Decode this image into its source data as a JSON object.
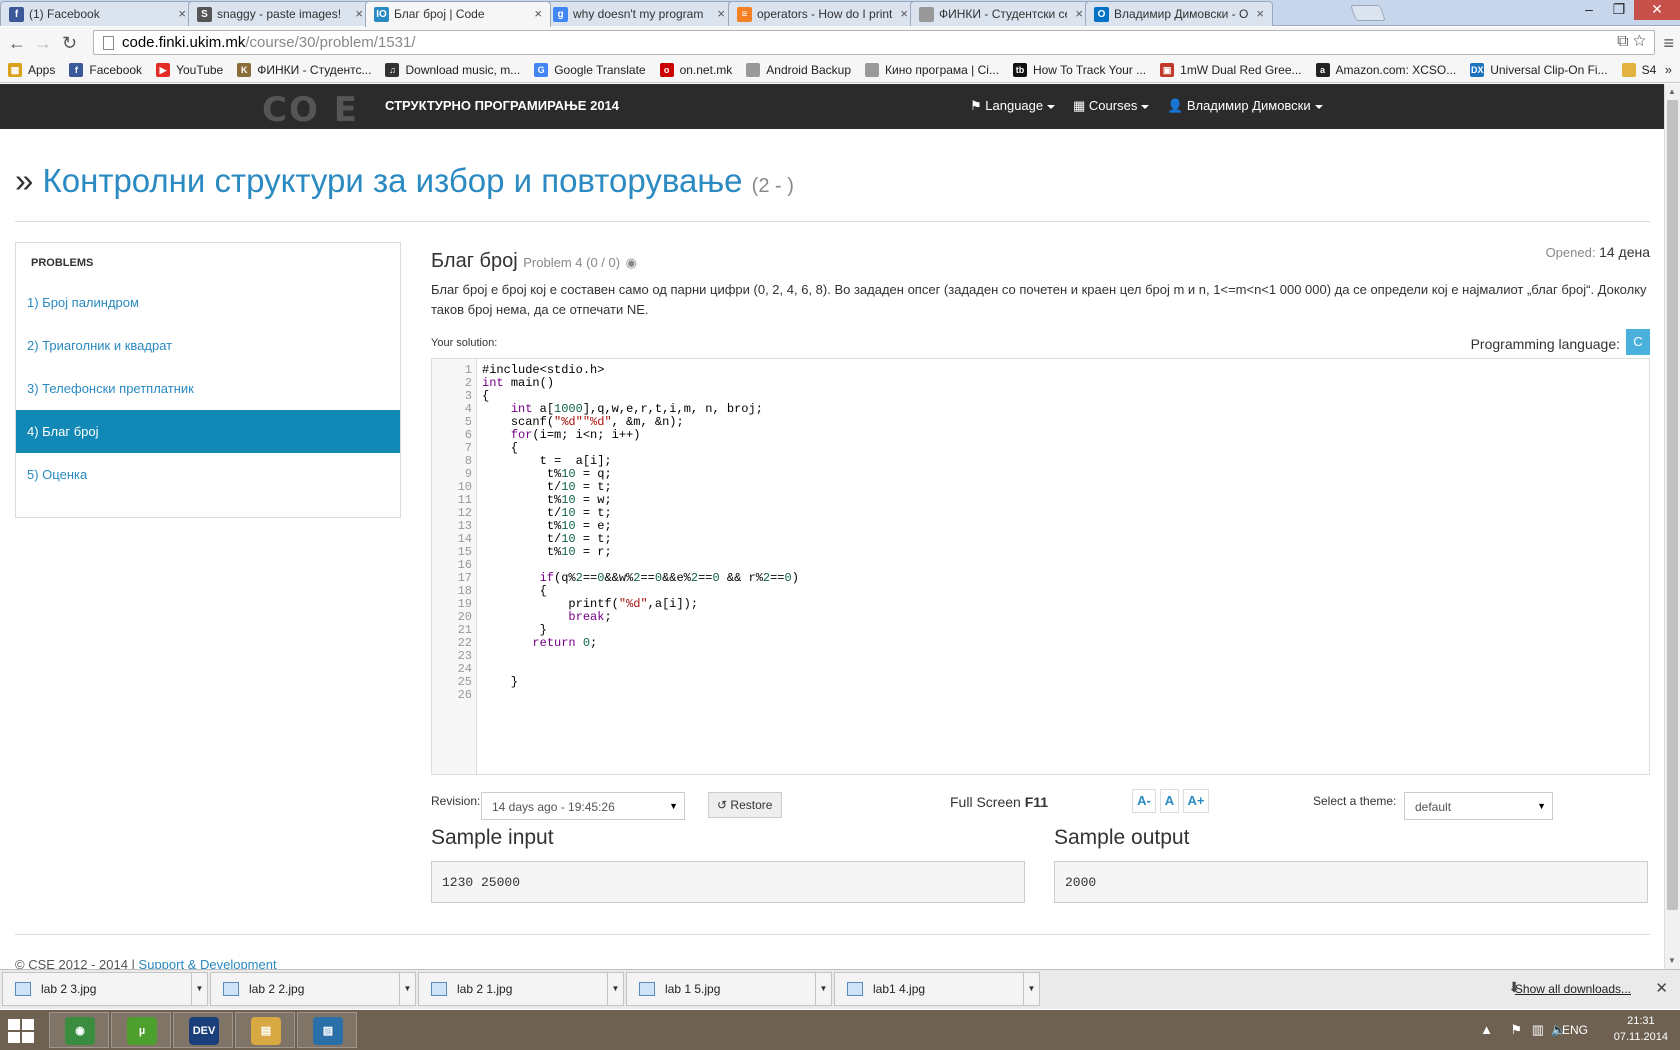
{
  "browser": {
    "tabs": [
      {
        "title": "(1) Facebook",
        "icon": "facebook-icon",
        "color": "#3b5998",
        "glyph": "f"
      },
      {
        "title": "snaggy - paste images!",
        "icon": "snaggy-icon",
        "color": "#555555",
        "glyph": "S"
      },
      {
        "title": "Благ број | Code",
        "icon": "code-icon",
        "color": "#2a8ac1",
        "glyph": "IO",
        "active": true
      },
      {
        "title": "why doesn't my program",
        "icon": "google-icon",
        "color": "#4285f4",
        "glyph": "g"
      },
      {
        "title": "operators - How do I print",
        "icon": "stackoverflow-icon",
        "color": "#f48024",
        "glyph": "≡"
      },
      {
        "title": "ФИНКИ - Студентски сер",
        "icon": "page-icon",
        "color": "#999999",
        "glyph": ""
      },
      {
        "title": "Владимир Димовски - О",
        "icon": "outlook-icon",
        "color": "#0072c6",
        "glyph": "O"
      }
    ],
    "url_host": "code.finki.ukim.mk",
    "url_path": "/course/30/problem/1531/",
    "bookmarks": [
      {
        "label": "Apps",
        "icon": "apps-icon",
        "color": "#d9a21b",
        "glyph": "▦"
      },
      {
        "label": "Facebook",
        "icon": "facebook-icon",
        "color": "#3b5998",
        "glyph": "f"
      },
      {
        "label": "YouTube",
        "icon": "youtube-icon",
        "color": "#e52d27",
        "glyph": "▶"
      },
      {
        "label": "ФИНКИ - Студентс...",
        "icon": "finki-icon",
        "color": "#8a6d3b",
        "glyph": "K"
      },
      {
        "label": "Download music, m...",
        "icon": "music-icon",
        "color": "#333333",
        "glyph": "♫"
      },
      {
        "label": "Google Translate",
        "icon": "translate-icon",
        "color": "#4285f4",
        "glyph": "G"
      },
      {
        "label": "on.net.mk",
        "icon": "onnet-icon",
        "color": "#cc0000",
        "glyph": "o"
      },
      {
        "label": "Android Backup",
        "icon": "page-icon",
        "color": "#999999",
        "glyph": ""
      },
      {
        "label": "Кино програма | Ci...",
        "icon": "page-icon",
        "color": "#999999",
        "glyph": ""
      },
      {
        "label": "How To Track Your ...",
        "icon": "tb-icon",
        "color": "#111111",
        "glyph": "tb"
      },
      {
        "label": "1mW Dual Red Gree...",
        "icon": "shop-icon",
        "color": "#c0392b",
        "glyph": "▣"
      },
      {
        "label": "Amazon.com: XCSO...",
        "icon": "amazon-icon",
        "color": "#222222",
        "glyph": "a"
      },
      {
        "label": "Universal Clip-On Fi...",
        "icon": "dx-icon",
        "color": "#1e73be",
        "glyph": "DX"
      },
      {
        "label": "S4",
        "icon": "folder-icon",
        "color": "#e3b341",
        "glyph": ""
      }
    ],
    "bookmarks_more": "»"
  },
  "site": {
    "logo": "CO  E",
    "course": "СТРУКТУРНО ПРОГРАМИРАЊЕ 2014",
    "nav": [
      {
        "label": "Language",
        "icon": "flag-icon"
      },
      {
        "label": "Courses",
        "icon": "grid-icon"
      },
      {
        "label": "Владимир Димовски",
        "icon": "user-icon"
      }
    ],
    "heading": "Контролни структури за избор и повторување",
    "heading_sub": "(2 - )",
    "sidebar_title": "PROBLEMS",
    "problems": [
      {
        "label": "1) Број палиндром"
      },
      {
        "label": "2) Триаголник и квадрат"
      },
      {
        "label": "3) Телефонски претплатник"
      },
      {
        "label": "4) Благ број",
        "active": true
      },
      {
        "label": "5) Оценка"
      }
    ]
  },
  "problem": {
    "title": "Благ број",
    "subtitle": "Problem 4 (0 / 0)",
    "opened_label": "Opened:",
    "opened_value": "14 дена",
    "description": "Благ број е број кој е составен само од парни цифри (0, 2, 4, 6, 8). Во зададен опсег (зададен со почетен и краен цел број m и n, 1<=m<n<1 000 000) да се определи кој е најмалиот „благ број“. Доколку таков број нема, да се отпечати NE.",
    "solution_label": "Your solution:",
    "language_label": "Programming language:",
    "language": "C"
  },
  "editor": {
    "code": [
      "#include<stdio.h>",
      "int main()",
      "{",
      "    int a[1000],q,w,e,r,t,i,m, n, broj;",
      "    scanf(\"%d\"\"%d\", &m, &n);",
      "    for(i=m; i<n; i++)",
      "    {",
      "        t =  a[i];",
      "         t%10 = q;",
      "         t/10 = t;",
      "         t%10 = w;",
      "         t/10 = t;",
      "         t%10 = e;",
      "         t/10 = t;",
      "         t%10 = r;",
      "",
      "        if(q%2==0&&w%2==0&&e%2==0 && r%2==0)",
      "        {",
      "            printf(\"%d\",a[i]);",
      "            break;",
      "        }",
      "       return 0;",
      "",
      "",
      "    }",
      ""
    ],
    "revision_label": "Revision:",
    "revision_value": "14 days ago - 19:45:26",
    "restore_label": "Restore",
    "fullscreen_label": "Full Screen",
    "fullscreen_key": "F11",
    "font_smaller": "A-",
    "font_reset": "A",
    "font_larger": "A+",
    "theme_label": "Select a theme:",
    "theme_value": "default"
  },
  "samples": {
    "input_title": "Sample input",
    "input_value": "1230 25000",
    "output_title": "Sample output",
    "output_value": "2000"
  },
  "footer": {
    "copyright": "© CSE 2012 - 2014 |",
    "link": "Support & Development"
  },
  "downloads": {
    "items": [
      "lab 2 3.jpg",
      "lab 2 2.jpg",
      "lab 2 1.jpg",
      "lab 1 5.jpg",
      "lab1 4.jpg"
    ],
    "show_all": "Show all downloads..."
  },
  "taskbar": {
    "apps": [
      {
        "name": "chrome",
        "color": "#3a8d3f",
        "glyph": "◉"
      },
      {
        "name": "utorrent",
        "color": "#4d9f2e",
        "glyph": "µ"
      },
      {
        "name": "devcpp",
        "color": "#1b3f7a",
        "glyph": "DEV"
      },
      {
        "name": "explorer",
        "color": "#d8a943",
        "glyph": "▤"
      },
      {
        "name": "photos",
        "color": "#2a6fa8",
        "glyph": "▨"
      }
    ],
    "language": "ENG",
    "time": "21:31",
    "date": "07.11.2014"
  }
}
